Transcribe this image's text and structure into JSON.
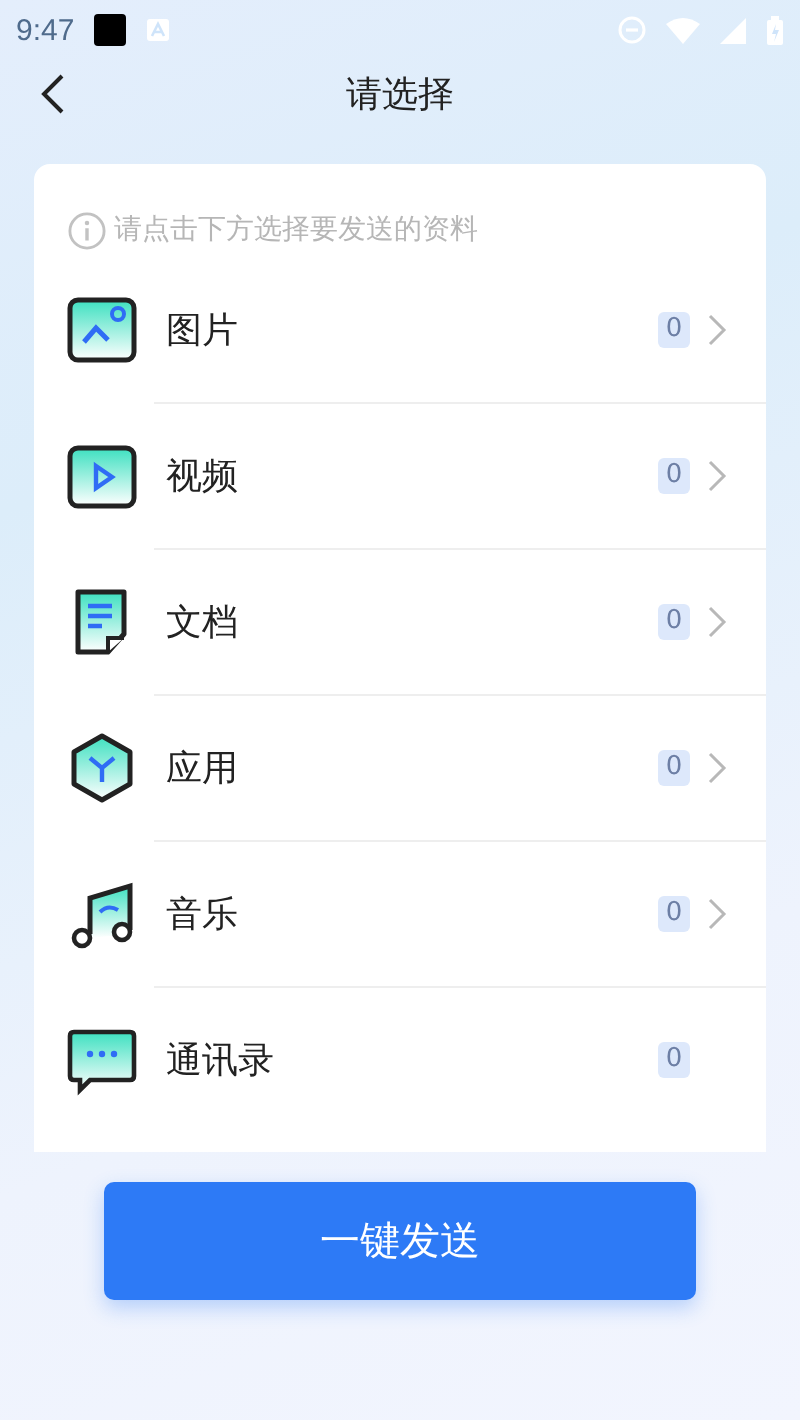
{
  "status_bar": {
    "time": "9:47"
  },
  "header": {
    "title": "请选择"
  },
  "tip": "请点击下方选择要发送的资料",
  "items": [
    {
      "kind": "image",
      "label": "图片",
      "count": "0",
      "has_arrow": true
    },
    {
      "kind": "video",
      "label": "视频",
      "count": "0",
      "has_arrow": true
    },
    {
      "kind": "document",
      "label": "文档",
      "count": "0",
      "has_arrow": true
    },
    {
      "kind": "app",
      "label": "应用",
      "count": "0",
      "has_arrow": true
    },
    {
      "kind": "music",
      "label": "音乐",
      "count": "0",
      "has_arrow": true
    },
    {
      "kind": "contacts",
      "label": "通讯录",
      "count": "0",
      "has_arrow": false
    }
  ],
  "send_button": "一键发送"
}
